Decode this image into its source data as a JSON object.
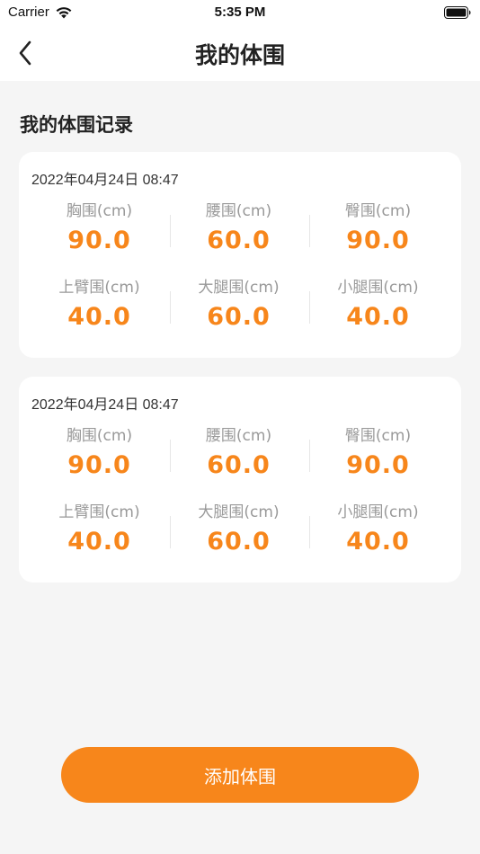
{
  "status_bar": {
    "carrier": "Carrier",
    "time": "5:35 PM"
  },
  "nav": {
    "title": "我的体围",
    "back_icon": "chevron-left-icon"
  },
  "section": {
    "title": "我的体围记录"
  },
  "records": [
    {
      "date": "2022年04月24日 08:47",
      "metrics": [
        {
          "label": "胸围(cm)",
          "value": "90.0"
        },
        {
          "label": "腰围(cm)",
          "value": "60.0"
        },
        {
          "label": "臀围(cm)",
          "value": "90.0"
        },
        {
          "label": "上臂围(cm)",
          "value": "40.0"
        },
        {
          "label": "大腿围(cm)",
          "value": "60.0"
        },
        {
          "label": "小腿围(cm)",
          "value": "40.0"
        }
      ]
    },
    {
      "date": "2022年04月24日 08:47",
      "metrics": [
        {
          "label": "胸围(cm)",
          "value": "90.0"
        },
        {
          "label": "腰围(cm)",
          "value": "60.0"
        },
        {
          "label": "臀围(cm)",
          "value": "90.0"
        },
        {
          "label": "上臂围(cm)",
          "value": "40.0"
        },
        {
          "label": "大腿围(cm)",
          "value": "60.0"
        },
        {
          "label": "小腿围(cm)",
          "value": "40.0"
        }
      ]
    }
  ],
  "add_button": {
    "label": "添加体围"
  },
  "colors": {
    "accent": "#f7861b",
    "background": "#f5f5f5",
    "card": "#ffffff",
    "label_gray": "#999999"
  }
}
